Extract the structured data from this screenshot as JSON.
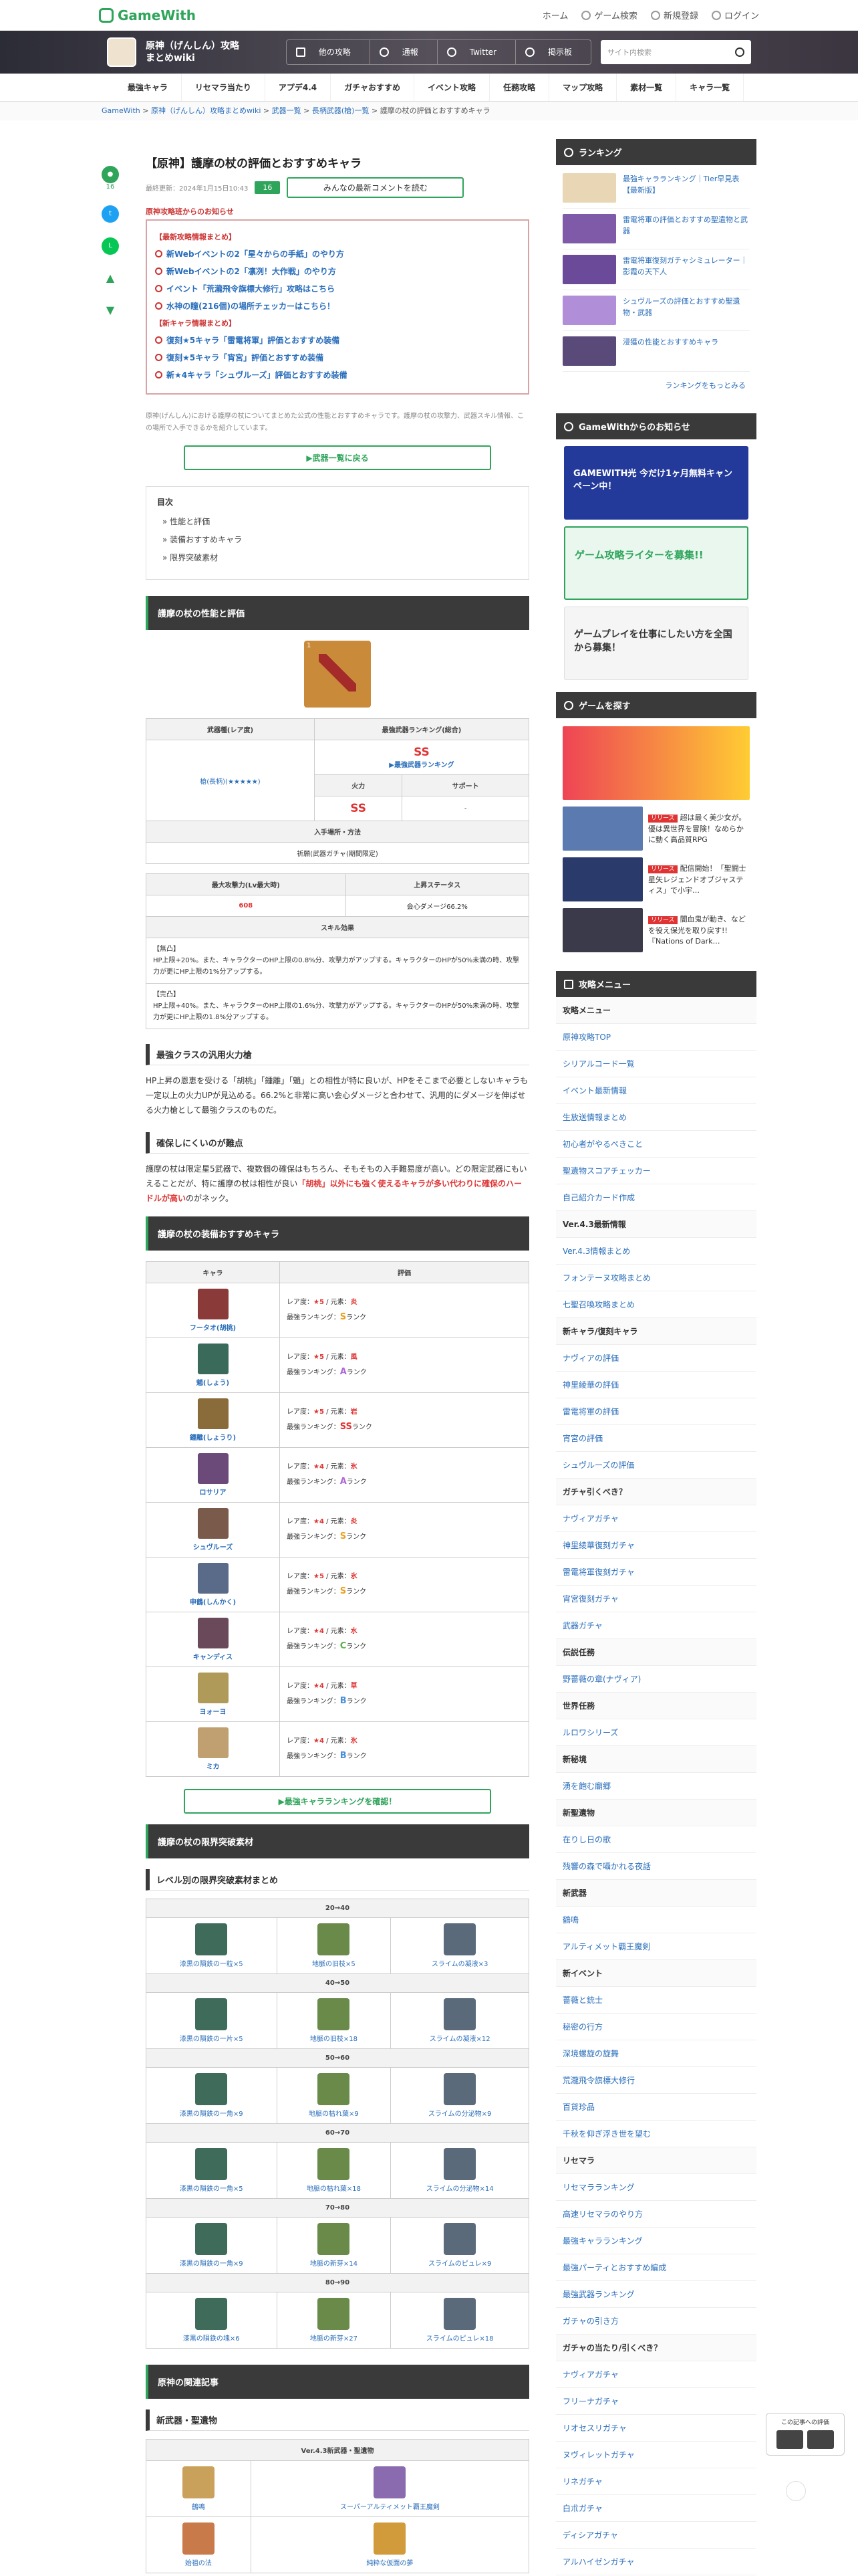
{
  "header": {
    "logo": "GameWith",
    "nav": [
      "ホーム",
      "ゲーム検索",
      "新規登録",
      "ログイン"
    ]
  },
  "banner": {
    "title": "原神（げんしん）攻略まとめwiki",
    "buttons": [
      "他の攻略",
      "通報",
      "Twitter",
      "掲示板"
    ],
    "search_placeholder": "サイト内検索"
  },
  "gnav": [
    "最強キャラ",
    "リセマラ当たり",
    "アプデ4.4",
    "ガチャおすすめ",
    "イベント攻略",
    "任務攻略",
    "マップ攻略",
    "素材一覧",
    "キャラ一覧"
  ],
  "breadcrumb": [
    "GameWith",
    "原神（げんしん）攻略まとめwiki",
    "武器一覧",
    "長柄武器(槍)一覧",
    "護摩の杖の評価とおすすめキャラ"
  ],
  "side": {
    "comment_count": "16"
  },
  "article": {
    "title": "【原神】護摩の杖の評価とおすすめキャラ",
    "updated": "最終更新：2024年1月15日10:43",
    "comment_badge": "16",
    "comment_btn": "みんなの最新コメントを読む",
    "notice_head": "原神攻略班からのお知らせ",
    "notice_sec1": "【最新攻略情報まとめ】",
    "notice_items1": [
      "新Webイベントの2「星々からの手紙」のやり方",
      "新Webイベントの2「凛冽！大作戦」のやり方",
      "イベント「荒瀧飛令旗標大修行」攻略はこちら",
      "水神の瞳(216個)の場所チェッカーはこちら！"
    ],
    "notice_sec2": "【新キャラ情報まとめ】",
    "notice_items2": [
      "復刻★5キャラ「雷電将軍」評価とおすすめ装備",
      "復刻★5キャラ「宵宮」評価とおすすめ装備",
      "新★4キャラ「シュヴルーズ」評価とおすすめ装備"
    ],
    "intro": "原神(げんしん)における護摩の杖についてまとめた公式の性能とおすすめキャラです。護摩の杖の攻撃力、武器スキル情報、この場所で入手できるかを紹介しています。",
    "back_btn": "▶武器一覧に戻る",
    "toc_title": "目次",
    "toc": [
      "性能と評価",
      "装備おすすめキャラ",
      "限界突破素材"
    ],
    "sec1": "護摩の杖の性能と評価",
    "weapon_level": "1",
    "stat_headers": [
      "武器種(レア度)",
      "最強武器ランキング(総合)"
    ],
    "weapon_type": "槍(長柄)(★★★★★)",
    "overall_rank": "SS",
    "rank_link": "▶最強武器ランキング",
    "sub_headers": [
      "火力",
      "サポート"
    ],
    "dps_rank": "SS",
    "support_rank": "-",
    "obtain_head": "入手場所・方法",
    "obtain": "祈願(武器ガチャ(期間限定)",
    "stat2_headers": [
      "最大攻撃力(Lv最大時)",
      "上昇ステータス"
    ],
    "max_atk": "608",
    "sub_stat": "会心ダメージ66.2%",
    "skill_head": "スキル効果",
    "skill1_title": "【無凸】",
    "skill1": "HP上限+20%。また、キャラクターのHP上限の0.8%分、攻撃力がアップする。キャラクターのHPが50%未満の時、攻撃力が更にHP上限の1%分アップする。",
    "skill2_title": "【完凸】",
    "skill2": "HP上限+40%。また、キャラクターのHP上限の1.6%分、攻撃力がアップする。キャラクターのHPが50%未満の時、攻撃力が更にHP上限の1.8%分アップする。",
    "h3a": "最強クラスの汎用火力槍",
    "pa": "HP上昇の恩恵を受ける「胡桃」「鍾離」「魈」との相性が特に良いが、HPをそこまで必要としないキャラも一定以上の火力UPが見込める。66.2%と非常に高い会心ダメージと合わせて、汎用的にダメージを伸ばせる火力槍として最強クラスのものだ。",
    "h3b": "確保しにくいのが難点",
    "pb": "護摩の杖は限定星5武器で、複数個の確保はもちろん、そもそもの入手難易度が高い。どの限定武器にもいえることだが、特に護摩の杖は相性が良い",
    "pb_red": "「胡桃」以外にも強く使えるキャラが多い代わりに確保のハードルが高い",
    "pb_end": "のがネック。",
    "sec2": "護摩の杖の装備おすすめキャラ",
    "char_headers": [
      "キャラ",
      "評価"
    ],
    "chars": [
      {
        "name": "フータオ(胡桃)",
        "rarity": "★5",
        "elem": "炎",
        "rank": "S"
      },
      {
        "name": "魈(しょう)",
        "rarity": "★5",
        "elem": "風",
        "rank": "A"
      },
      {
        "name": "鍾離(しょうり)",
        "rarity": "★5",
        "elem": "岩",
        "rank": "SS"
      },
      {
        "name": "ロサリア",
        "rarity": "★4",
        "elem": "氷",
        "rank": "A"
      },
      {
        "name": "シュヴルーズ",
        "rarity": "★4",
        "elem": "炎",
        "rank": "S"
      },
      {
        "name": "申鶴(しんかく)",
        "rarity": "★5",
        "elem": "氷",
        "rank": "S"
      },
      {
        "name": "キャンディス",
        "rarity": "★4",
        "elem": "水",
        "rank": "C"
      },
      {
        "name": "ヨォーヨ",
        "rarity": "★4",
        "elem": "草",
        "rank": "B"
      },
      {
        "name": "ミカ",
        "rarity": "★4",
        "elem": "氷",
        "rank": "B"
      }
    ],
    "eval_labels": {
      "rarity": "レア度：",
      "elem": "元素：",
      "rank": "最強ランキング：",
      "suffix": "ランク"
    },
    "char_rank_btn": "▶最強キャラランキングを確認！",
    "sec3": "護摩の杖の限界突破素材",
    "h3c": "レベル別の限界突破素材まとめ",
    "asc": [
      {
        "range": "20→40",
        "mats": [
          "漆黒の隕鉄の一粒×5",
          "地脈の旧枝×5",
          "スライムの凝液×3"
        ]
      },
      {
        "range": "40→50",
        "mats": [
          "漆黒の隕鉄の一片×5",
          "地脈の旧枝×18",
          "スライムの凝液×12"
        ]
      },
      {
        "range": "50→60",
        "mats": [
          "漆黒の隕鉄の一角×9",
          "地脈の枯れ葉×9",
          "スライムの分泌物×9"
        ]
      },
      {
        "range": "60→70",
        "mats": [
          "漆黒の隕鉄の一角×5",
          "地脈の枯れ葉×18",
          "スライムの分泌物×14"
        ]
      },
      {
        "range": "70→80",
        "mats": [
          "漆黒の隕鉄の一角×9",
          "地脈の新芽×14",
          "スライムのピュレ×9"
        ]
      },
      {
        "range": "80→90",
        "mats": [
          "漆黒の隕鉄の塊×6",
          "地脈の新芽×27",
          "スライムのピュレ×18"
        ]
      }
    ],
    "sec4": "原神の関連記事",
    "h3d": "新武器・聖遺物",
    "rel_head": "Ver.4.3新武器・聖遺物",
    "rel": [
      "鶴鳴",
      "スーパーアルティメット覇王魔剣",
      "始祖の法",
      "純粋な仮面の夢"
    ]
  },
  "aside": {
    "ranking_title": "ランキング",
    "ranking": [
      "最強キャラランキング｜Tier早見表【最新版】",
      "雷電将軍の評価とおすすめ聖遺物と武器",
      "雷電将軍復刻ガチャシミュレーター｜影霞の天下人",
      "シュヴルーズの評価とおすすめ聖遺物・武器",
      "浸獲の性能とおすすめキャラ"
    ],
    "ranking_more": "ランキングをもっとみる",
    "notice_title": "GameWithからのお知らせ",
    "promo": [
      "GAMEWITH光 今だけ1ヶ月無料キャンペーン中！",
      "ゲーム攻略ライターを募集!!",
      "ゲームプレイを仕事にしたい方を全国から募集！"
    ],
    "games_title": "ゲームを探す",
    "games": [
      {
        "tag": "",
        "text": ""
      },
      {
        "tag": "リリース",
        "text": "超は最く美少女が。優は異世界を冒険！なめらかに動く高品質RPG"
      },
      {
        "tag": "リリース",
        "text": "配信開始！「聖闘士星矢レジェンドオブジャスティス」で小宇…"
      },
      {
        "tag": "リリース",
        "text": "闇血鬼が動き、などを役え保光を取り戻す!!『Nations of Dark…"
      }
    ],
    "menu_title": "攻略メニュー",
    "menu": [
      {
        "cat": true,
        "label": "攻略メニュー"
      },
      {
        "label": "原神攻略TOP"
      },
      {
        "label": "シリアルコード一覧"
      },
      {
        "label": "イベント最新情報"
      },
      {
        "label": "生放送情報まとめ"
      },
      {
        "label": "初心者がやるべきこと"
      },
      {
        "label": "聖遺物スコアチェッカー"
      },
      {
        "label": "自己紹介カード作成"
      },
      {
        "cat": true,
        "label": "Ver.4.3最新情報"
      },
      {
        "label": "Ver.4.3情報まとめ"
      },
      {
        "label": "フォンテーヌ攻略まとめ"
      },
      {
        "label": "七聖召喚攻略まとめ"
      },
      {
        "cat": true,
        "label": "新キャラ/復刻キャラ"
      },
      {
        "label": "ナヴィアの評価"
      },
      {
        "label": "神里綾華の評価"
      },
      {
        "label": "雷電将軍の評価"
      },
      {
        "label": "宵宮の評価"
      },
      {
        "label": "シュヴルーズの評価"
      },
      {
        "cat": true,
        "label": "ガチャ引くべき？"
      },
      {
        "label": "ナヴィアガチャ"
      },
      {
        "label": "神里綾華復刻ガチャ"
      },
      {
        "label": "雷電将軍復刻ガチャ"
      },
      {
        "label": "宵宮復刻ガチャ"
      },
      {
        "label": "武器ガチャ"
      },
      {
        "cat": true,
        "label": "伝説任務"
      },
      {
        "label": "野薔薇の章(ナヴィア)"
      },
      {
        "cat": true,
        "label": "世界任務"
      },
      {
        "label": "ルロワシリーズ"
      },
      {
        "cat": true,
        "label": "新秘境"
      },
      {
        "label": "湧を飽む廟郷"
      },
      {
        "cat": true,
        "label": "新聖遺物"
      },
      {
        "label": "在りし日の歌"
      },
      {
        "label": "残響の森で囁かれる夜話"
      },
      {
        "cat": true,
        "label": "新武器"
      },
      {
        "label": "鶴鳴"
      },
      {
        "label": "アルティメット覇王魔剣"
      },
      {
        "cat": true,
        "label": "新イベント"
      },
      {
        "label": "薔薇と銃士"
      },
      {
        "label": "秘密の行方"
      },
      {
        "label": "深境螺旋の旋舞"
      },
      {
        "label": "荒瀧飛令旗標大修行"
      },
      {
        "label": "百貨珍品"
      },
      {
        "label": "千秋を仰ぎ浮き世を望む"
      },
      {
        "cat": true,
        "label": "リセマラ"
      },
      {
        "label": "リセマラランキング"
      },
      {
        "label": "高速リセマラのやり方"
      },
      {
        "label": "最強キャラランキング"
      },
      {
        "label": "最強パーティとおすすめ編成"
      },
      {
        "label": "最強武器ランキング"
      },
      {
        "label": "ガチャの引き方"
      },
      {
        "cat": true,
        "label": "ガチャの当たり/引くべき？"
      },
      {
        "label": "ナヴィアガチャ"
      },
      {
        "label": "フリーナガチャ"
      },
      {
        "label": "リオセスリガチャ"
      },
      {
        "label": "ヌヴィレットガチャ"
      },
      {
        "label": "リネガチャ"
      },
      {
        "label": "白朮ガチャ"
      },
      {
        "label": "ディシアガチャ"
      },
      {
        "label": "アルハイゼンガチャ"
      }
    ]
  },
  "float": {
    "label": "この記事への評価"
  }
}
